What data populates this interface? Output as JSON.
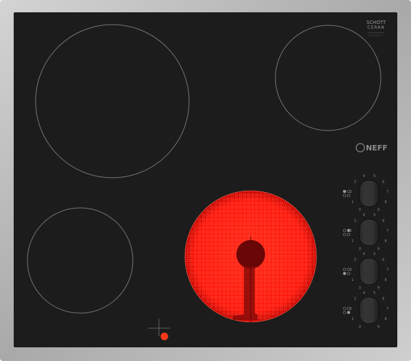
{
  "product": {
    "glass_maker_line1": "SCHOTT",
    "glass_maker_line2": "CERAN",
    "brand": "NEFF",
    "colors": {
      "frame": "#b8b8b8",
      "glass": "#1c1c1c",
      "zone_outline": "#7a7a7a",
      "active_zone": "#ff1e1e",
      "indicator_light": "#ff3a1a"
    }
  },
  "zones": [
    {
      "id": "front-right",
      "state": "on"
    },
    {
      "id": "rear-left",
      "state": "off"
    },
    {
      "id": "rear-right",
      "state": "off"
    },
    {
      "id": "front-left",
      "state": "off"
    }
  ],
  "knobs": [
    {
      "id": "knob-1",
      "scale": [
        "0",
        "1",
        "2",
        "3",
        "4",
        "5",
        "6",
        "7",
        "8",
        "9"
      ]
    },
    {
      "id": "knob-2",
      "scale": [
        "0",
        "1",
        "2",
        "3",
        "4",
        "5",
        "6",
        "7",
        "8",
        "9"
      ]
    },
    {
      "id": "knob-3",
      "scale": [
        "0",
        "1",
        "2",
        "3",
        "4",
        "5",
        "6",
        "7",
        "8",
        "9"
      ]
    },
    {
      "id": "knob-4",
      "scale": [
        "0",
        "1",
        "2",
        "3",
        "4",
        "5",
        "6",
        "7",
        "8",
        "9"
      ]
    }
  ]
}
